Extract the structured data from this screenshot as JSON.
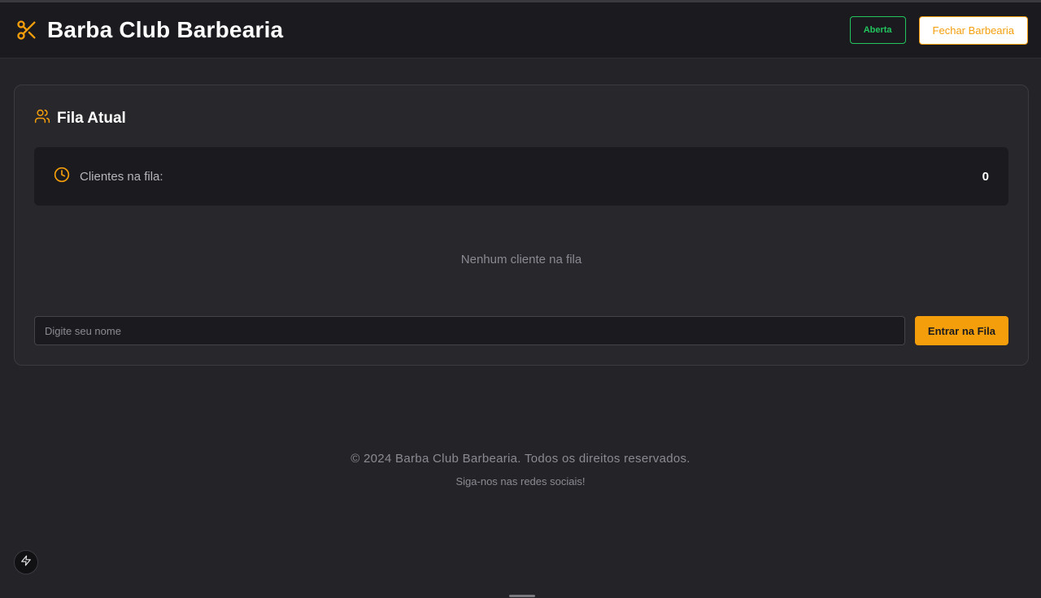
{
  "header": {
    "title": "Barba Club Barbearia",
    "status": "Aberta",
    "close_button": "Fechar Barbearia",
    "logo_icon": "scissors-icon"
  },
  "queue": {
    "title": "Fila Atual",
    "title_icon": "users-icon",
    "count_label": "Clientes na fila:",
    "count_icon": "clock-icon",
    "count_value": "0",
    "empty_message": "Nenhum cliente na fila",
    "name_input": {
      "placeholder": "Digite seu nome",
      "value": ""
    },
    "join_button": "Entrar na Fila"
  },
  "footer": {
    "copyright": "© 2024 Barba Club Barbearia. Todos os direitos reservados.",
    "social": "Siga-nos nas redes sociais!"
  },
  "colors": {
    "accent": "#f59e0b",
    "status_open": "#22c55e",
    "background": "#242428",
    "surface": "#27272c"
  }
}
